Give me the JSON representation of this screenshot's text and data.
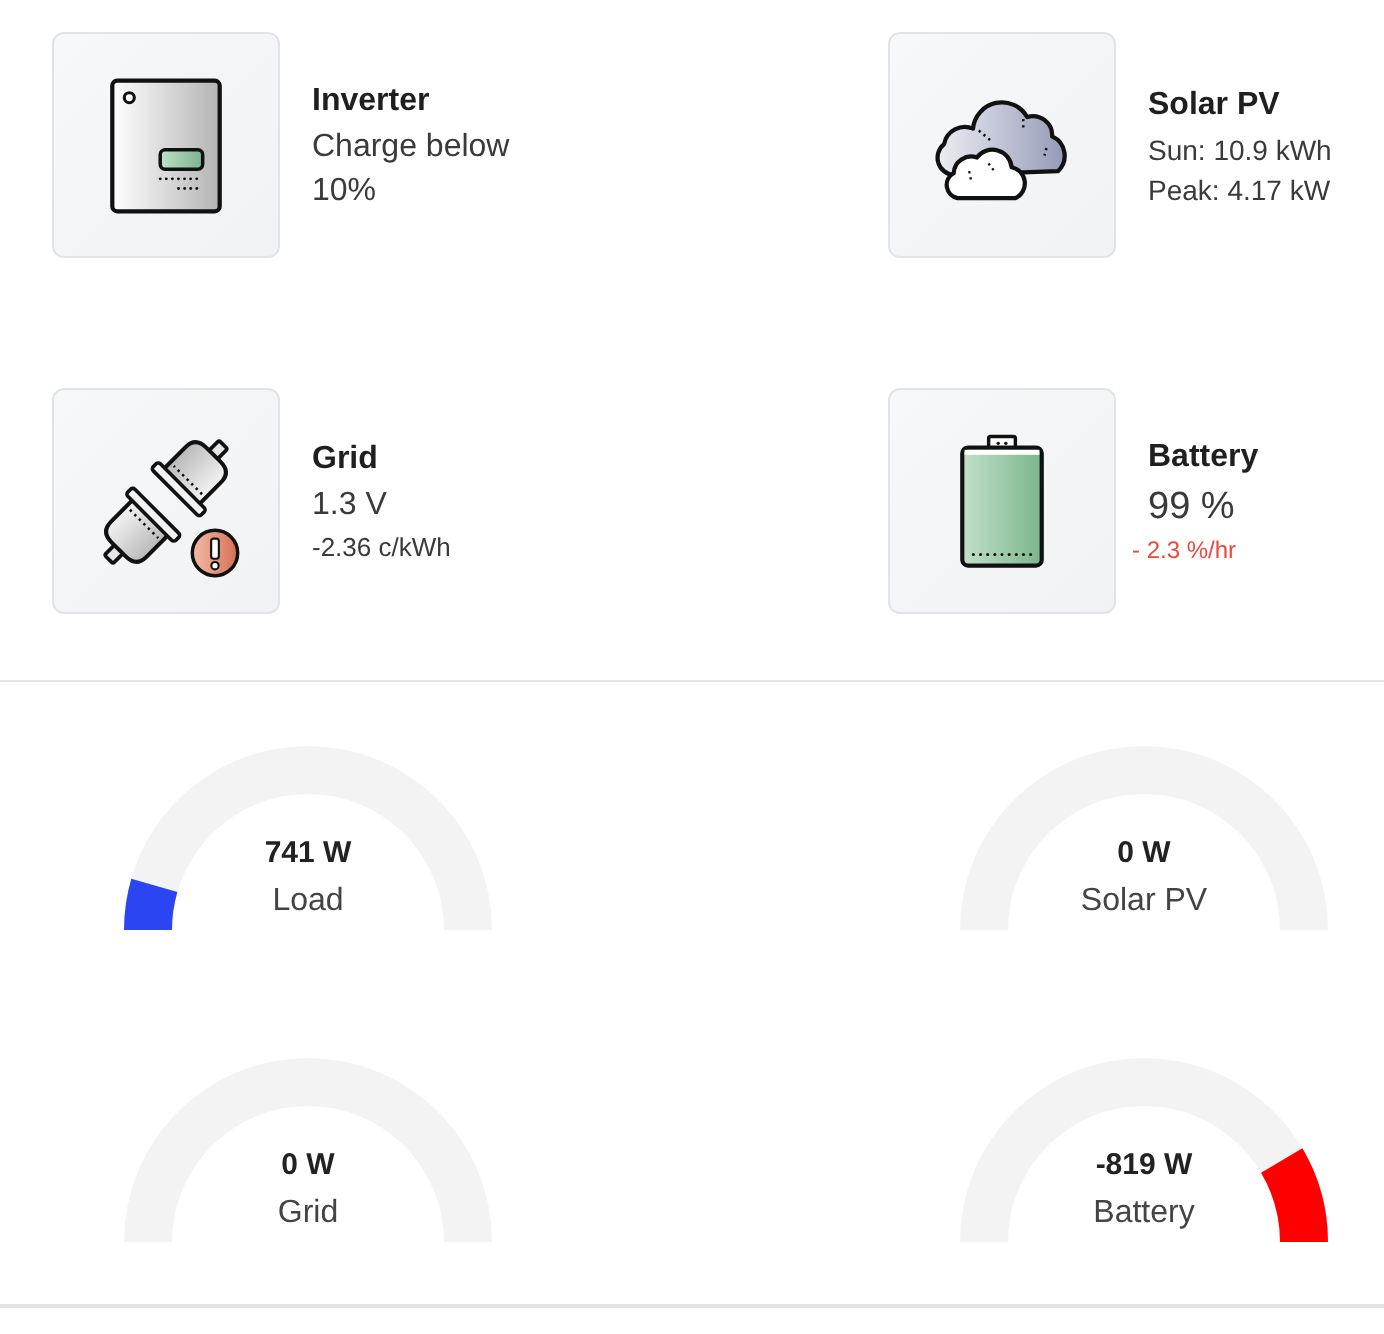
{
  "devices": [
    {
      "kind": "inverter",
      "title": "Inverter",
      "warning": false,
      "lines": [
        "Charge below 10%"
      ]
    },
    {
      "kind": "solar",
      "title": "Solar PV",
      "warning": false,
      "lines": [
        "Sun: 10.9 kWh",
        "Peak: 4.17 kW"
      ]
    },
    {
      "kind": "grid",
      "title": "Grid",
      "warning": true,
      "lines": [
        "1.3 V",
        "-2.36 c/kWh"
      ]
    },
    {
      "kind": "battery",
      "title": "Battery",
      "warning": false,
      "lines": [
        "99 %",
        "- 2.3 %/hr"
      ]
    }
  ],
  "gauges": [
    {
      "kind": "load",
      "value": "741 W",
      "label": "Load",
      "level": 0.09,
      "color": "#2b45f2"
    },
    {
      "kind": "solar",
      "value": "0 W",
      "label": "Solar PV"
    },
    {
      "kind": "grid",
      "value": "0 W",
      "label": "Grid"
    },
    {
      "kind": "battery",
      "value": "-819 W",
      "label": "Battery",
      "level": 0.17,
      "color": "#ff0000"
    }
  ]
}
